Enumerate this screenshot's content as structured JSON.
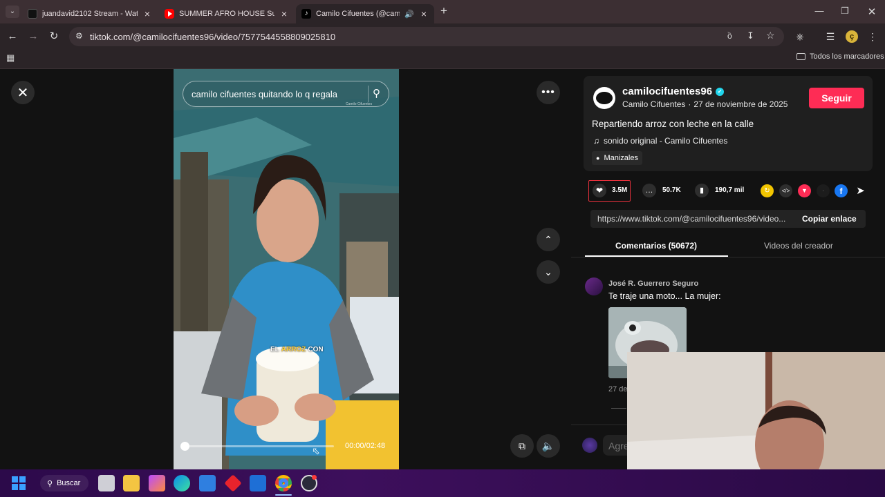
{
  "browser": {
    "tabs": [
      {
        "label": "juandavid2102 Stream - Watch",
        "favicon": "dark-square"
      },
      {
        "label": "SUMMER AFRO HOUSE Sunset",
        "favicon": "youtube"
      },
      {
        "label": "Camilo Cifuentes (@camilo",
        "favicon": "tiktok"
      }
    ],
    "url": "tiktok.com/@camilocifuentes96/video/7577544558809025810",
    "bookmarks_label": "Todos los marcadores",
    "profile_initial": "ç"
  },
  "video": {
    "search_text": "camilo cifuentes quitando lo q regala",
    "watermark": "Camilo Cifuentes",
    "caption_overlay": {
      "word1": "EL",
      "word2": "ARROZ",
      "word3": "CON"
    },
    "time": "00:00/02:48",
    "progress": 0.02
  },
  "post": {
    "username": "camilocifuentes96",
    "display_name": "Camilo Cifuentes",
    "date": "27 de noviembre de 2025",
    "follow_label": "Seguir",
    "description": "Repartiendo arroz con leche en la calle",
    "sound": "sonido original - Camilo Cifuentes",
    "location": "Manizales",
    "likes": "3.5M",
    "comments": "50.7K",
    "saves": "190,7 mil",
    "link": "https://www.tiktok.com/@camilocifuentes96/video...",
    "copy_label": "Copiar enlace"
  },
  "tabs": {
    "comments": "Comentarios (50672)",
    "creator": "Videos del creador"
  },
  "comment": {
    "author": "José R. Guerrero Seguro",
    "text": "Te traje una moto... La mujer:",
    "date": "27 de"
  },
  "compose_placeholder": "Agre",
  "taskbar": {
    "search_label": "Buscar"
  },
  "colors": {
    "accent": "#fe2c55",
    "verified": "#20d5ec",
    "taskbar": "#3d0f5c"
  }
}
